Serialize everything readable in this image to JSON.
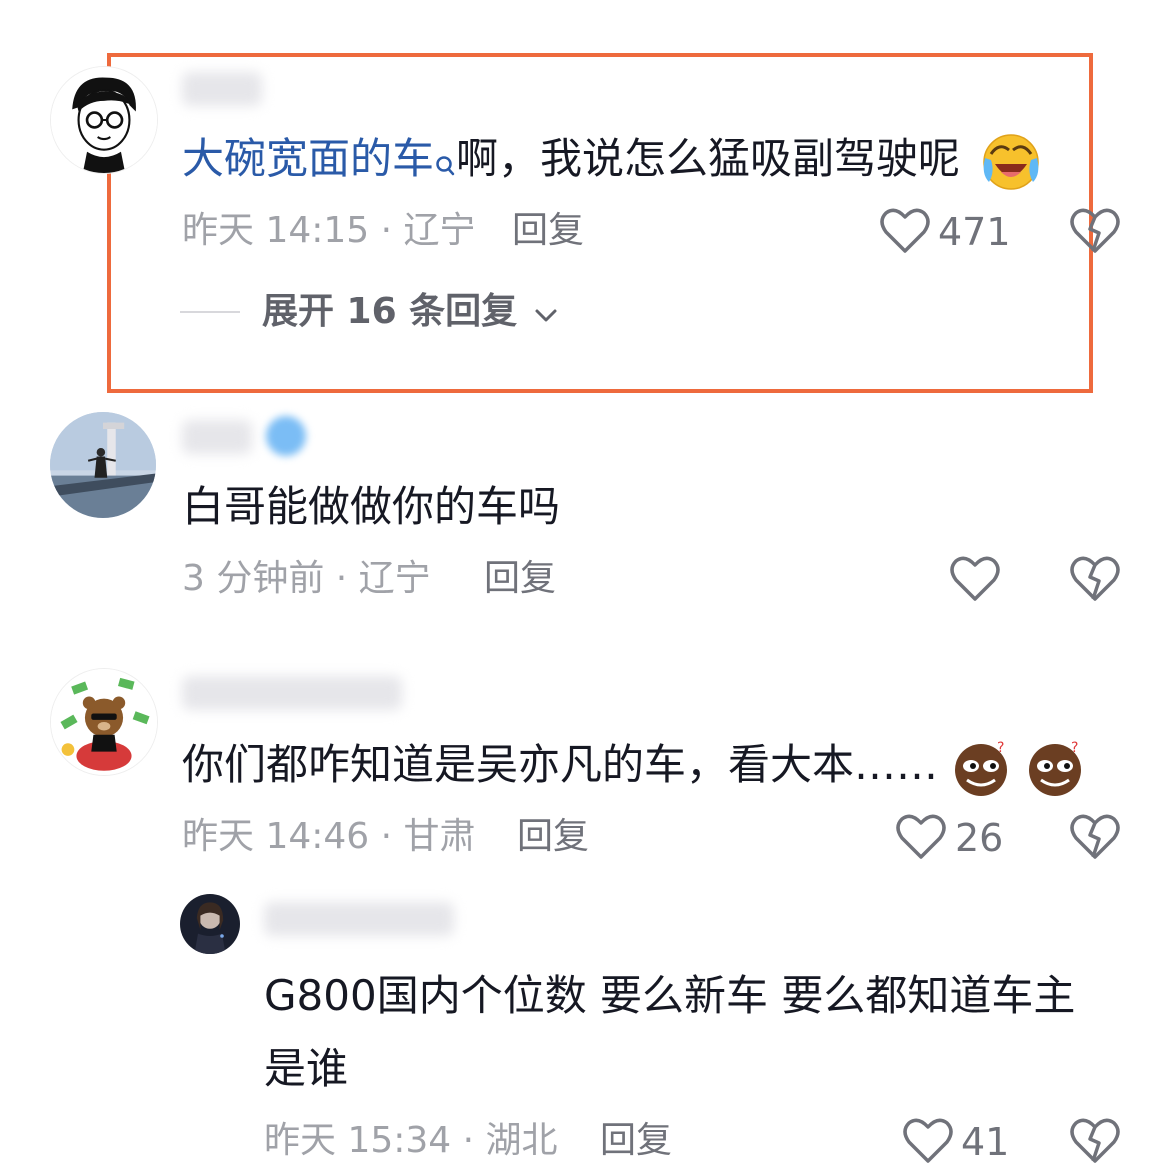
{
  "comments": [
    {
      "mention_link": "大碗宽面的车",
      "text": "啊，我说怎么猛吸副驾驶呢",
      "time_location": "昨天 14:15 · 辽宁",
      "reply_label": "回复",
      "likes": "471",
      "expand_label": "展开 16 条回复",
      "emoji": "crying-laughing-face"
    },
    {
      "text": "白哥能做做你的车吗",
      "time_location": "3 分钟前 · 辽宁",
      "reply_label": "回复",
      "likes": ""
    },
    {
      "text": "你们都咋知道是吴亦凡的车，看大本……",
      "time_location": "昨天 14:46 · 甘肃",
      "reply_label": "回复",
      "likes": "26",
      "emoji": "smirking-emoji"
    }
  ],
  "sub_reply": {
    "text_line1": "G800国内个位数 要么新车 要么都知道车主",
    "text_line2": "是谁",
    "time_location": "昨天 15:34 · 湖北",
    "reply_label": "回复",
    "likes": "41"
  },
  "colors": {
    "highlight": "#ee6a3d",
    "link": "#2a5aa8",
    "meta": "#a0a2a8"
  }
}
